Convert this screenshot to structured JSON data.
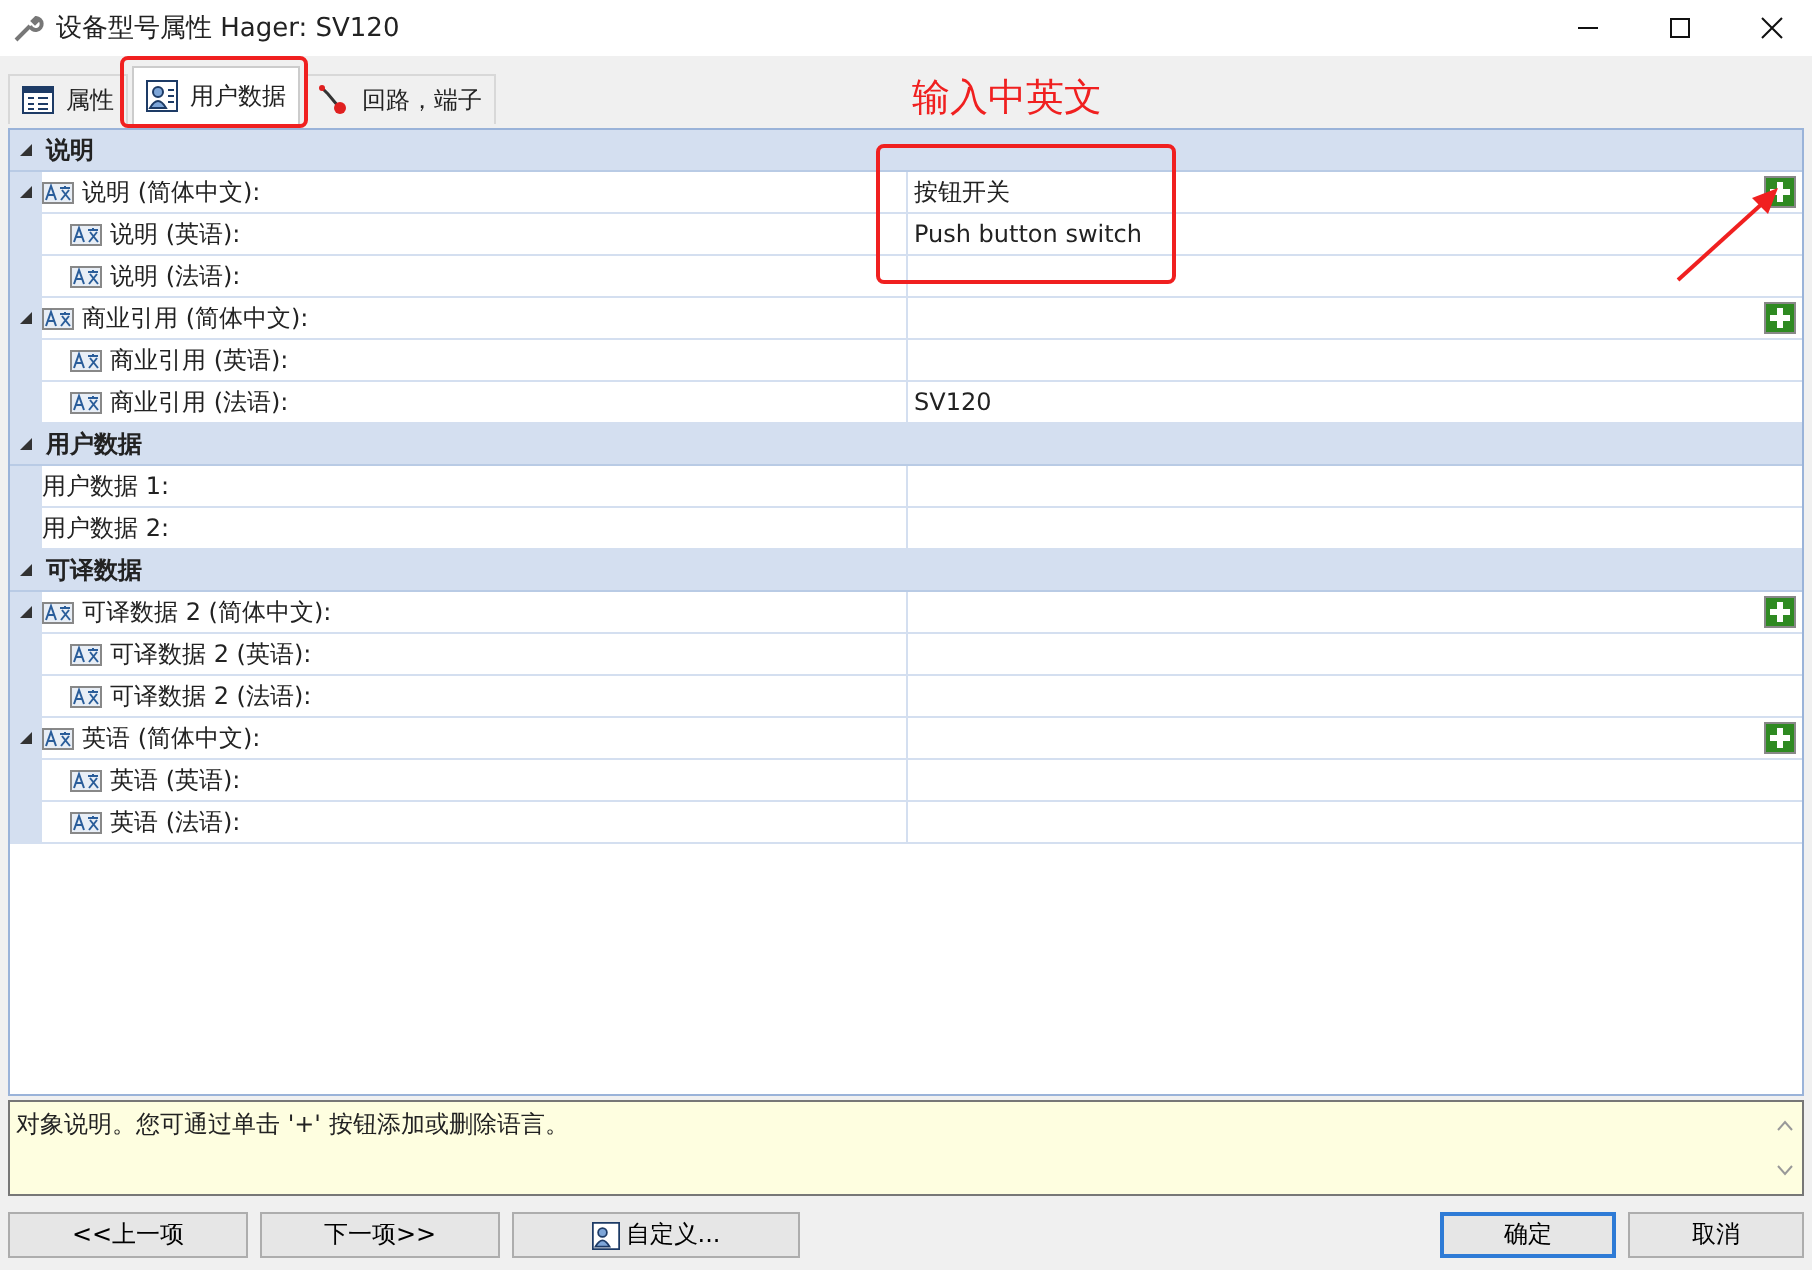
{
  "window": {
    "title": "设备型号属性 Hager: SV120"
  },
  "tabs": [
    {
      "label": "属性",
      "selected": false
    },
    {
      "label": "用户数据",
      "selected": true
    },
    {
      "label": "回路，端子",
      "selected": false
    }
  ],
  "groups": [
    {
      "title": "说明",
      "expanded": true,
      "rows": [
        {
          "label": "说明 (简体中文):",
          "value": "按钮开关",
          "kind": "translatable",
          "expanded": true,
          "add_button": true,
          "children": [
            {
              "label": "说明 (英语):",
              "value": "Push button switch",
              "kind": "translatable"
            },
            {
              "label": "说明 (法语):",
              "kind": "translatable"
            }
          ]
        },
        {
          "label": "商业引用 (简体中文):",
          "kind": "translatable",
          "expanded": true,
          "add_button": true,
          "children": [
            {
              "label": "商业引用 (英语):",
              "kind": "translatable"
            },
            {
              "label": "商业引用 (法语):",
              "value": "SV120",
              "kind": "translatable"
            }
          ]
        }
      ]
    },
    {
      "title": "用户数据",
      "expanded": true,
      "rows": [
        {
          "label": "用户数据 1:",
          "kind": "plain"
        },
        {
          "label": "用户数据 2:",
          "kind": "plain"
        }
      ]
    },
    {
      "title": "可译数据",
      "expanded": true,
      "rows": [
        {
          "label": "可译数据 2 (简体中文):",
          "kind": "translatable",
          "expanded": true,
          "add_button": true,
          "children": [
            {
              "label": "可译数据 2 (英语):",
              "kind": "translatable"
            },
            {
              "label": "可译数据 2 (法语):",
              "kind": "translatable"
            }
          ]
        },
        {
          "label": "英语 (简体中文):",
          "kind": "translatable",
          "expanded": true,
          "add_button": true,
          "children": [
            {
              "label": "英语 (英语):",
              "kind": "translatable"
            },
            {
              "label": "英语 (法语):",
              "kind": "translatable"
            }
          ]
        }
      ]
    }
  ],
  "description": "对象说明。您可通过单击 '+' 按钮添加或删除语言。",
  "buttons": [
    {
      "label": "<<上一项",
      "kind": "plain"
    },
    {
      "label": "下一项>>",
      "kind": "plain"
    },
    {
      "label": "自定义...",
      "kind": "icon"
    },
    {
      "label": "确定",
      "kind": "default"
    },
    {
      "label": "取消",
      "kind": "plain"
    }
  ],
  "annotation": {
    "label": "输入中英文"
  }
}
